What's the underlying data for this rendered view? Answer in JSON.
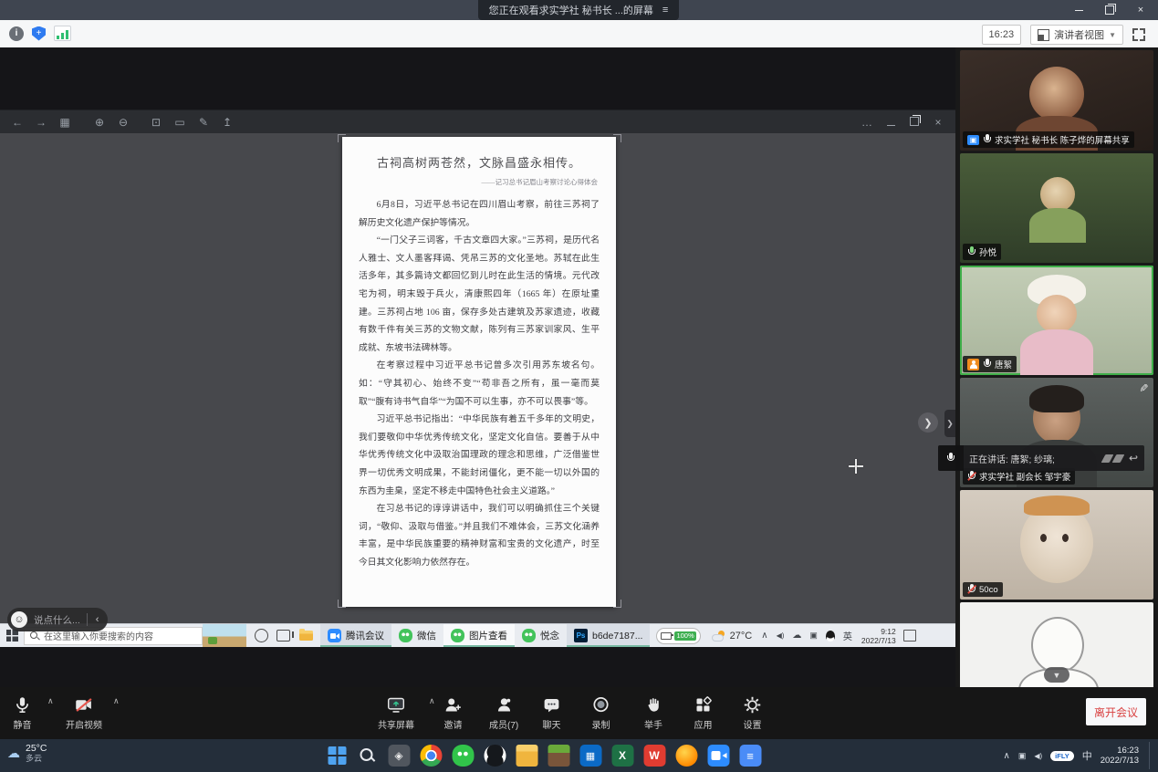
{
  "meeting": {
    "banner_text": "您正在观看求实学社 秘书长 ...的屏幕",
    "clock": "16:23",
    "view_mode": "演讲者视图",
    "speaking_banner": "正在讲话: 唐絮; 纱璃;",
    "chat_placeholder": "说点什么...",
    "leave_label": "离开会议",
    "controls": {
      "mute": "静音",
      "video": "开启视频",
      "share": "共享屏幕",
      "invite": "邀请",
      "members": "成员(7)",
      "chat": "聊天",
      "record": "录制",
      "hand": "举手",
      "apps": "应用",
      "settings": "设置"
    },
    "icons": [
      "info-icon",
      "shield-icon",
      "network-signal-icon",
      "fullscreen-icon"
    ]
  },
  "document": {
    "title": "古祠高树两苍然，文脉昌盛永相传。",
    "subtitle": "——记习总书记眉山考察讨论心得体会",
    "paragraphs": [
      "6月8日，习近平总书记在四川眉山考察，前往三苏祠了解历史文化遗产保护等情况。",
      "“一门父子三词客，千古文章四大家。”三苏祠，是历代名人雅士、文人墨客拜谒、凭吊三苏的文化圣地。苏轼在此生活多年，其多篇诗文都回忆到儿时在此生活的情境。元代改宅为祠，明末毁于兵火，清康熙四年（1665 年）在原址重建。三苏祠占地 106 亩，保存多处古建筑及苏家遗迹，收藏有数千件有关三苏的文物文献，陈列有三苏家训家风、生平成就、东坡书法碑林等。",
      "在考察过程中习近平总书记曾多次引用苏东坡名句。如：“守其初心、始终不变”“苟非吾之所有，虽一毫而莫取”“腹有诗书气自华”“为国不可以生事，亦不可以畏事”等。",
      "习近平总书记指出：“中华民族有着五千多年的文明史，我们要敬仰中华优秀传统文化，坚定文化自信。要善于从中华优秀传统文化中汲取治国理政的理念和思维，广泛借鉴世界一切优秀文明成果，不能封闭僵化，更不能一切以外国的东西为圭臬，坚定不移走中国特色社会主义道路。”",
      "在习总书记的谆谆讲话中，我们可以明确抓住三个关键词，“敬仰、汲取与借鉴。”并且我们不难体会，三苏文化涵养丰富，是中华民族重要的精神财富和宝贵的文化遗产，时至今日其文化影响力依然存在。"
    ]
  },
  "participants": [
    {
      "label": "求实学社 秘书长 陈子烨的屏幕共享",
      "mic": "on",
      "sharing": true
    },
    {
      "label": "孙悦",
      "mic": "on"
    },
    {
      "label": "唐絮",
      "mic": "on",
      "active_speaker": true,
      "host_badge": true
    },
    {
      "label": "求实学社 副会长 邹宇豪",
      "mic": "muted",
      "annotating": true
    },
    {
      "label": "50co",
      "mic": "muted"
    },
    {
      "label": ""
    }
  ],
  "presenter_desktop": {
    "search_placeholder": "在这里输入你要搜索的内容",
    "apps": [
      "腾讯会议",
      "微信",
      "图片查看",
      "悦念",
      "b6de7187..."
    ],
    "battery": "100%",
    "weather_temp": "27°C",
    "input_lang": "英",
    "time": "9:12",
    "date": "2022/7/13",
    "tray_icons": [
      "chevron-up-icon",
      "volume-icon",
      "cloud-icon",
      "monitor-icon",
      "qq-icon"
    ]
  },
  "viewer_desktop": {
    "weather_temp": "25°C",
    "weather_desc": "多云",
    "ime_badge": "iFLY",
    "input_lang": "中",
    "time": "16:23",
    "date": "2022/7/13",
    "app_icons": [
      "start-icon",
      "search-icon",
      "dark-app-icon",
      "chrome-icon",
      "wechat-icon",
      "qq-icon",
      "folder-icon",
      "minecraft-icon",
      "calculator-icon",
      "excel-icon",
      "wps-icon",
      "browser-icon",
      "tencent-meeting-icon",
      "docs-icon"
    ]
  }
}
